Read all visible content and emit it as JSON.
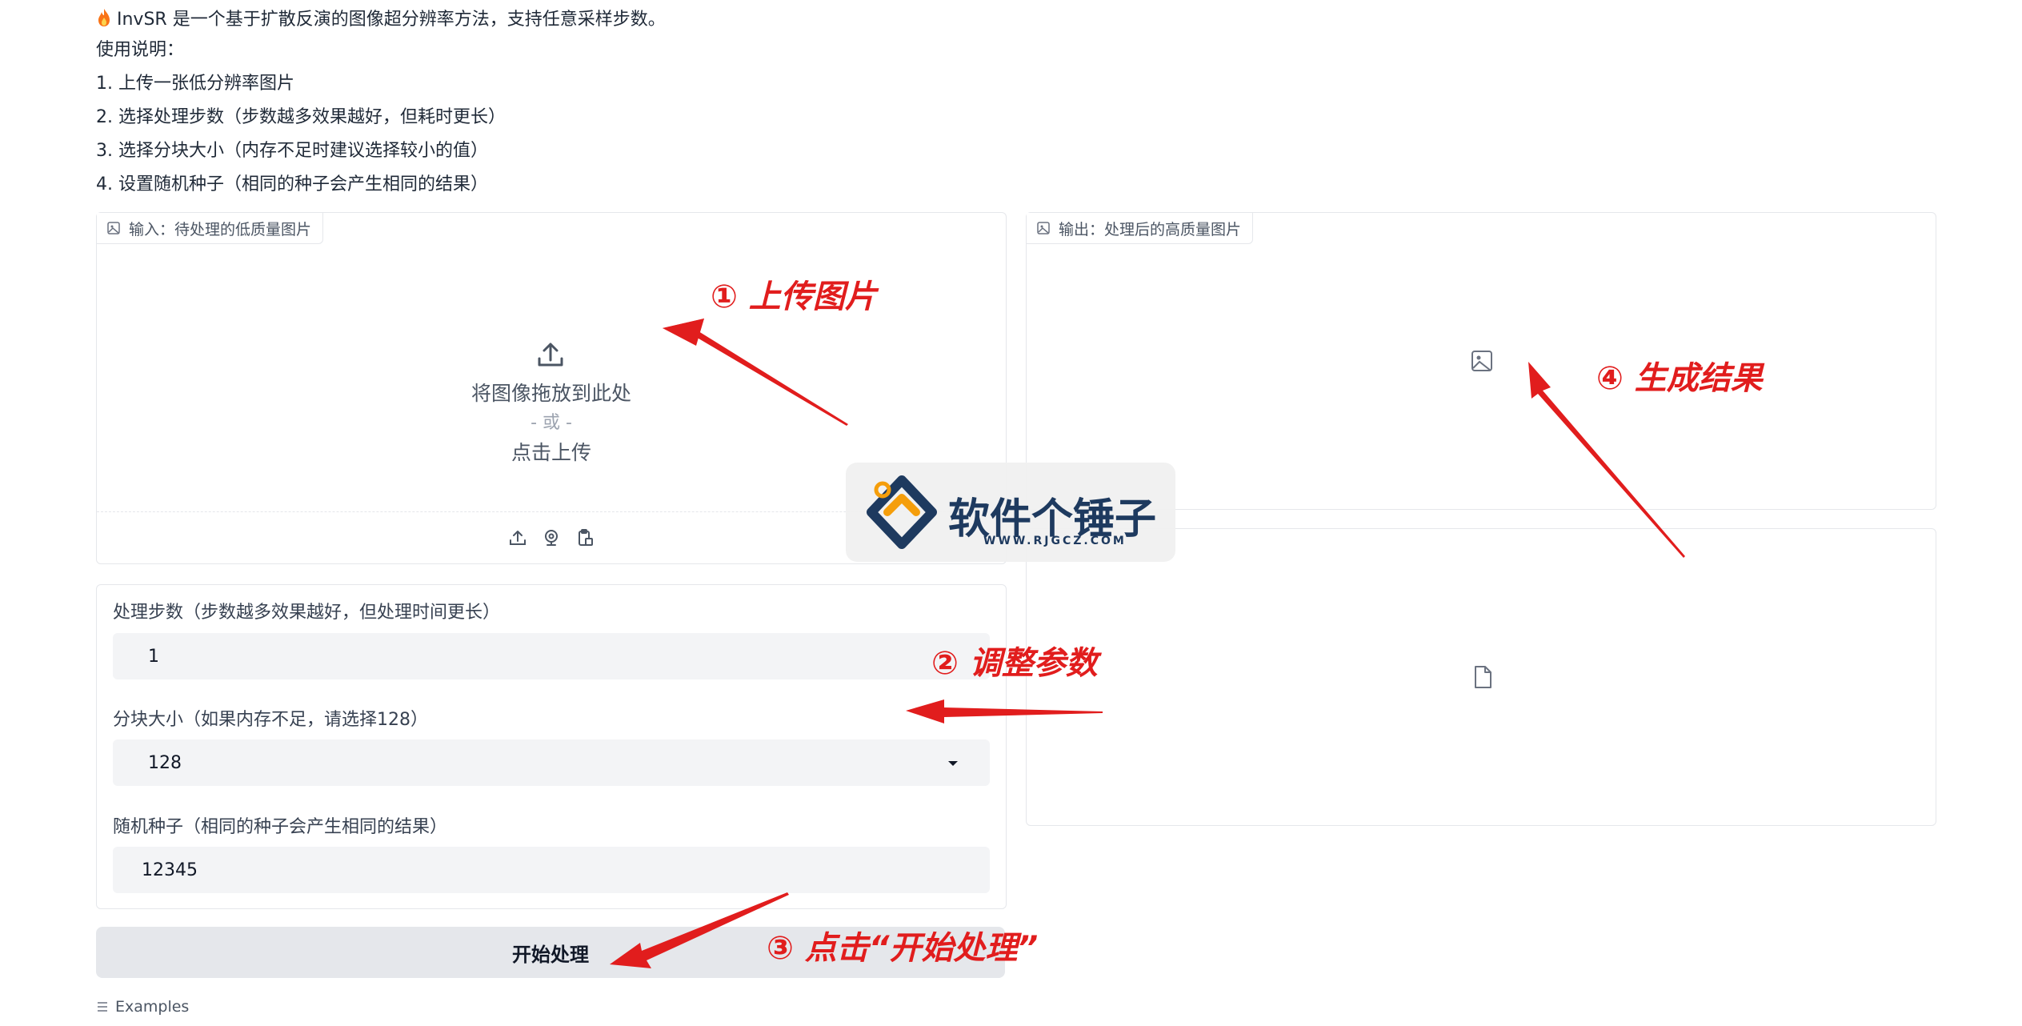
{
  "intro": {
    "title": "InvSR 是一个基于扩散反演的图像超分辨率方法，支持任意采样步数。",
    "usage_heading": "使用说明：",
    "steps": [
      "1. 上传一张低分辨率图片",
      "2. 选择处理步数（步数越多效果越好，但耗时更长）",
      "3. 选择分块大小（内存不足时建议选择较小的值）",
      "4. 设置随机种子（相同的种子会产生相同的结果）"
    ]
  },
  "input_panel": {
    "label": "输入：待处理的低质量图片",
    "drop_text": "将图像拖放到此处",
    "or_text": "- 或 -",
    "click_text": "点击上传"
  },
  "output_panel": {
    "label": "输出：处理后的高质量图片"
  },
  "params": {
    "steps_label": "处理步数（步数越多效果越好，但处理时间更长）",
    "steps_value": "1",
    "chunk_label": "分块大小（如果内存不足，请选择128）",
    "chunk_value": "128",
    "seed_label": "随机种子（相同的种子会产生相同的结果）",
    "seed_value": "12345"
  },
  "start_button": "开始处理",
  "examples_label": "Examples",
  "annotations": {
    "a1": "① 上传图片",
    "a2": "② 调整参数",
    "a3": "③ 点击“开始处理”",
    "a4": "④ 生成结果"
  },
  "watermark": {
    "name": "软件个锤子",
    "url": "WWW.RJGCZ.COM"
  },
  "colors": {
    "annotation_red": "#e11d1d",
    "field_bg": "#f3f4f6",
    "button_bg": "#e5e7eb",
    "border": "#e5e7eb"
  }
}
